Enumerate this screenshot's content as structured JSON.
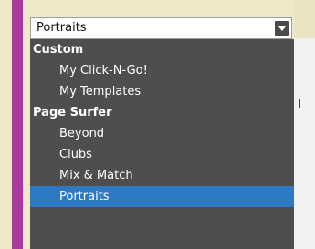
{
  "select": {
    "selected_value": "Portraits",
    "arrow_icon": "chevron-down-icon"
  },
  "menu": {
    "groups": [
      {
        "label": "Custom",
        "options": [
          {
            "label": "My Click-N-Go!"
          },
          {
            "label": "My Templates"
          }
        ]
      },
      {
        "label": "Page Surfer",
        "options": [
          {
            "label": "Beyond"
          },
          {
            "label": "Clubs"
          },
          {
            "label": "Mix & Match"
          },
          {
            "label": "Portraits",
            "selected": true
          }
        ]
      }
    ]
  },
  "colors": {
    "accent_stripe": "#a63b9c",
    "menu_background": "#4e4e4e",
    "selected_background": "#2d79c4",
    "page_background": "#efe9c9"
  }
}
